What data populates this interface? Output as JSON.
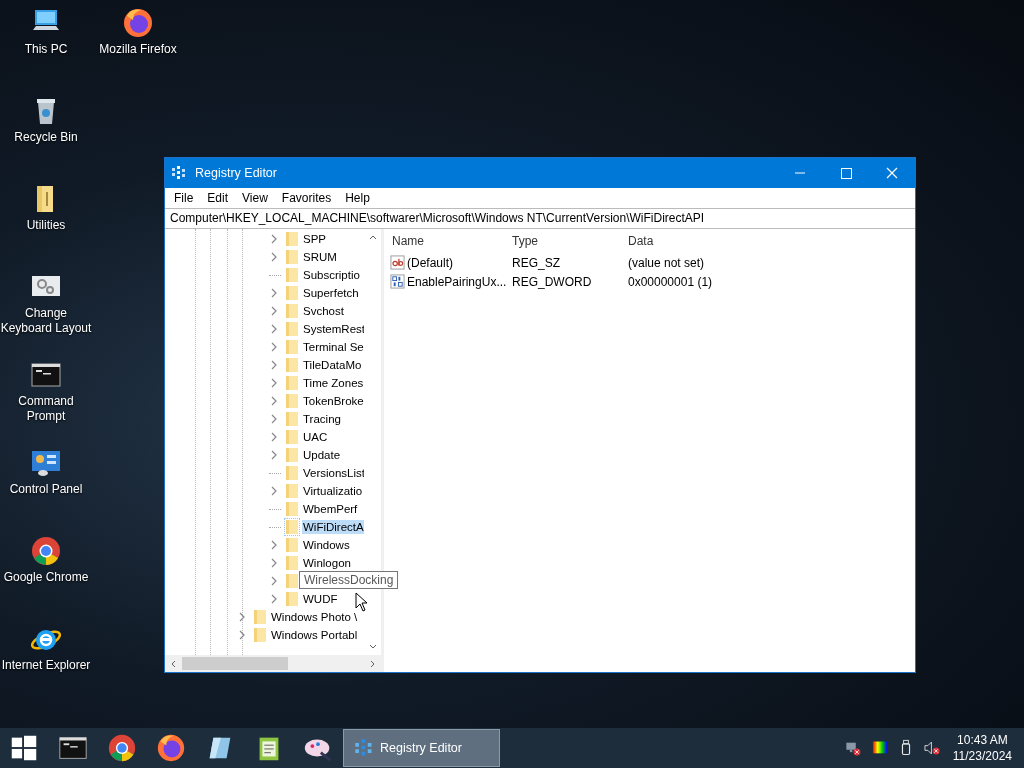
{
  "desktop_columns": [
    [
      {
        "label": "This PC",
        "kind": "pc"
      },
      {
        "label": "Recycle Bin",
        "kind": "recycle"
      },
      {
        "label": "Utilities",
        "kind": "folder"
      },
      {
        "label": "Change Keyboard Layout",
        "kind": "gears"
      },
      {
        "label": "Command Prompt",
        "kind": "cmd"
      },
      {
        "label": "Control Panel",
        "kind": "control"
      },
      {
        "label": "Google Chrome",
        "kind": "chrome"
      },
      {
        "label": "Internet Explorer",
        "kind": "ie"
      }
    ],
    [
      {
        "label": "Mozilla Firefox",
        "kind": "firefox"
      }
    ]
  ],
  "window": {
    "title": "Registry Editor",
    "menu": [
      "File",
      "Edit",
      "View",
      "Favorites",
      "Help"
    ],
    "address": "Computer\\HKEY_LOCAL_MACHINE\\softwarer\\Microsoft\\Windows NT\\CurrentVersion\\WiFiDirectAPI",
    "tree_inner": [
      {
        "label": "SPP",
        "expandable": true,
        "selected": false
      },
      {
        "label": "SRUM",
        "expandable": true,
        "selected": false
      },
      {
        "label": "Subscriptio",
        "expandable": false,
        "selected": false
      },
      {
        "label": "Superfetch",
        "expandable": true,
        "selected": false
      },
      {
        "label": "Svchost",
        "expandable": true,
        "selected": false
      },
      {
        "label": "SystemRest",
        "expandable": true,
        "selected": false
      },
      {
        "label": "Terminal Se",
        "expandable": true,
        "selected": false
      },
      {
        "label": "TileDataMo",
        "expandable": true,
        "selected": false
      },
      {
        "label": "Time Zones",
        "expandable": true,
        "selected": false
      },
      {
        "label": "TokenBroke",
        "expandable": true,
        "selected": false
      },
      {
        "label": "Tracing",
        "expandable": true,
        "selected": false
      },
      {
        "label": "UAC",
        "expandable": true,
        "selected": false
      },
      {
        "label": "Update",
        "expandable": true,
        "selected": false
      },
      {
        "label": "VersionsList",
        "expandable": false,
        "selected": false
      },
      {
        "label": "Virtualizatio",
        "expandable": true,
        "selected": false
      },
      {
        "label": "WbemPerf",
        "expandable": false,
        "selected": false
      },
      {
        "label": "WiFiDirectA",
        "expandable": false,
        "selected": true
      },
      {
        "label": "Windows",
        "expandable": true,
        "selected": false
      },
      {
        "label": "Winlogon",
        "expandable": true,
        "selected": false
      },
      {
        "expandable": true,
        "selected": false
      },
      {
        "label": "WUDF",
        "expandable": true,
        "selected": false
      }
    ],
    "tree_outer": [
      {
        "label": "Windows Photo \\",
        "expandable": true,
        "selected": false
      },
      {
        "label": "Windows Portabl",
        "expandable": true,
        "selected": false
      }
    ],
    "tooltip": "WirelessDocking",
    "columns": [
      "Name",
      "Type",
      "Data"
    ],
    "values": [
      {
        "kind": "string",
        "name": "(Default)",
        "type": "REG_SZ",
        "data": "(value not set)"
      },
      {
        "kind": "binary",
        "name": "EnablePairingUx...",
        "type": "REG_DWORD",
        "data": "0x00000001 (1)"
      }
    ]
  },
  "taskbar": {
    "pinned": [
      {
        "kind": "start"
      },
      {
        "kind": "cmd"
      },
      {
        "kind": "chrome"
      },
      {
        "kind": "firefox"
      },
      {
        "kind": "glass"
      },
      {
        "kind": "notepad"
      },
      {
        "kind": "paint"
      }
    ],
    "tasks": [
      {
        "label": "Registry Editor",
        "selected": true
      }
    ],
    "tray": [
      {
        "kind": "network"
      },
      {
        "kind": "color"
      },
      {
        "kind": "usb"
      },
      {
        "kind": "volume"
      }
    ],
    "time": "10:43 AM",
    "date": "11/23/2024"
  }
}
